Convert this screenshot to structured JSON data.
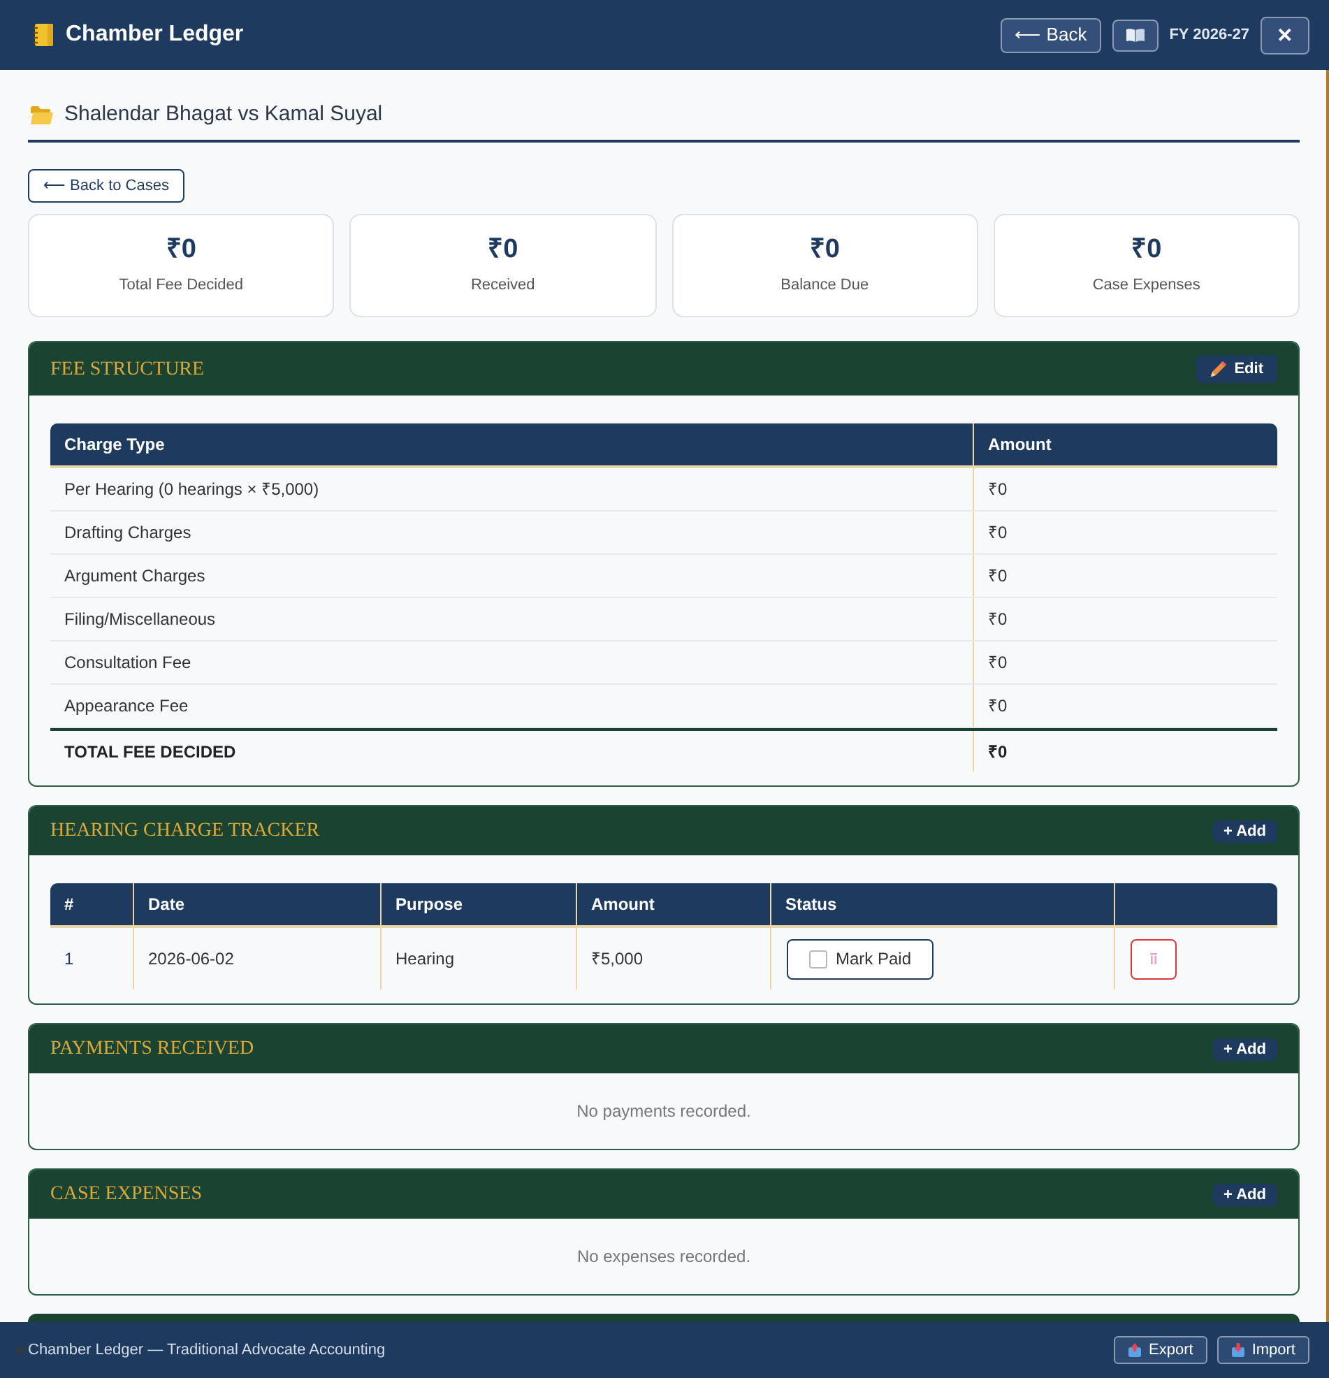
{
  "header": {
    "title": "Chamber Ledger",
    "back_button": "⟵ Back",
    "fy_label": "FY 2026-27",
    "close_button": "✕"
  },
  "case": {
    "title": "Shalendar Bhagat vs Kamal Suyal",
    "back_button": "⟵ Back to Cases"
  },
  "summary_cards": [
    {
      "value": "₹0",
      "label": "Total Fee Decided"
    },
    {
      "value": "₹0",
      "label": "Received"
    },
    {
      "value": "₹0",
      "label": "Balance Due"
    },
    {
      "value": "₹0",
      "label": "Case Expenses"
    }
  ],
  "fee_structure": {
    "title": "FEE STRUCTURE",
    "edit_button": "Edit",
    "columns": [
      "Charge Type",
      "Amount"
    ],
    "rows": [
      {
        "charge_type": "Per Hearing (0 hearings × ₹5,000)",
        "amount": "₹0"
      },
      {
        "charge_type": "Drafting Charges",
        "amount": "₹0"
      },
      {
        "charge_type": "Argument Charges",
        "amount": "₹0"
      },
      {
        "charge_type": "Filing/Miscellaneous",
        "amount": "₹0"
      },
      {
        "charge_type": "Consultation Fee",
        "amount": "₹0"
      },
      {
        "charge_type": "Appearance Fee",
        "amount": "₹0"
      }
    ],
    "total": {
      "label": "TOTAL FEE DECIDED",
      "amount": "₹0"
    }
  },
  "hearing_tracker": {
    "title": "HEARING CHARGE TRACKER",
    "add_button": "+ Add",
    "columns": [
      "#",
      "Date",
      "Purpose",
      "Amount",
      "Status"
    ],
    "rows": [
      {
        "number": "1",
        "date": "2026-06-02",
        "purpose": "Hearing",
        "amount": "₹5,000",
        "mark_paid": {
          "label": "Mark Paid",
          "checked": false
        }
      }
    ]
  },
  "payments_received": {
    "title": "PAYMENTS RECEIVED",
    "add_button": "+ Add",
    "empty_message": "No payments recorded."
  },
  "case_expenses": {
    "title": "CASE EXPENSES",
    "add_button": "+ Add",
    "empty_message": "No expenses recorded."
  },
  "footer": {
    "text": "Chamber Ledger — Traditional Advocate Accounting",
    "buttons": [
      {
        "kind": "export",
        "label": "Export"
      },
      {
        "kind": "import",
        "label": "Import"
      }
    ]
  }
}
